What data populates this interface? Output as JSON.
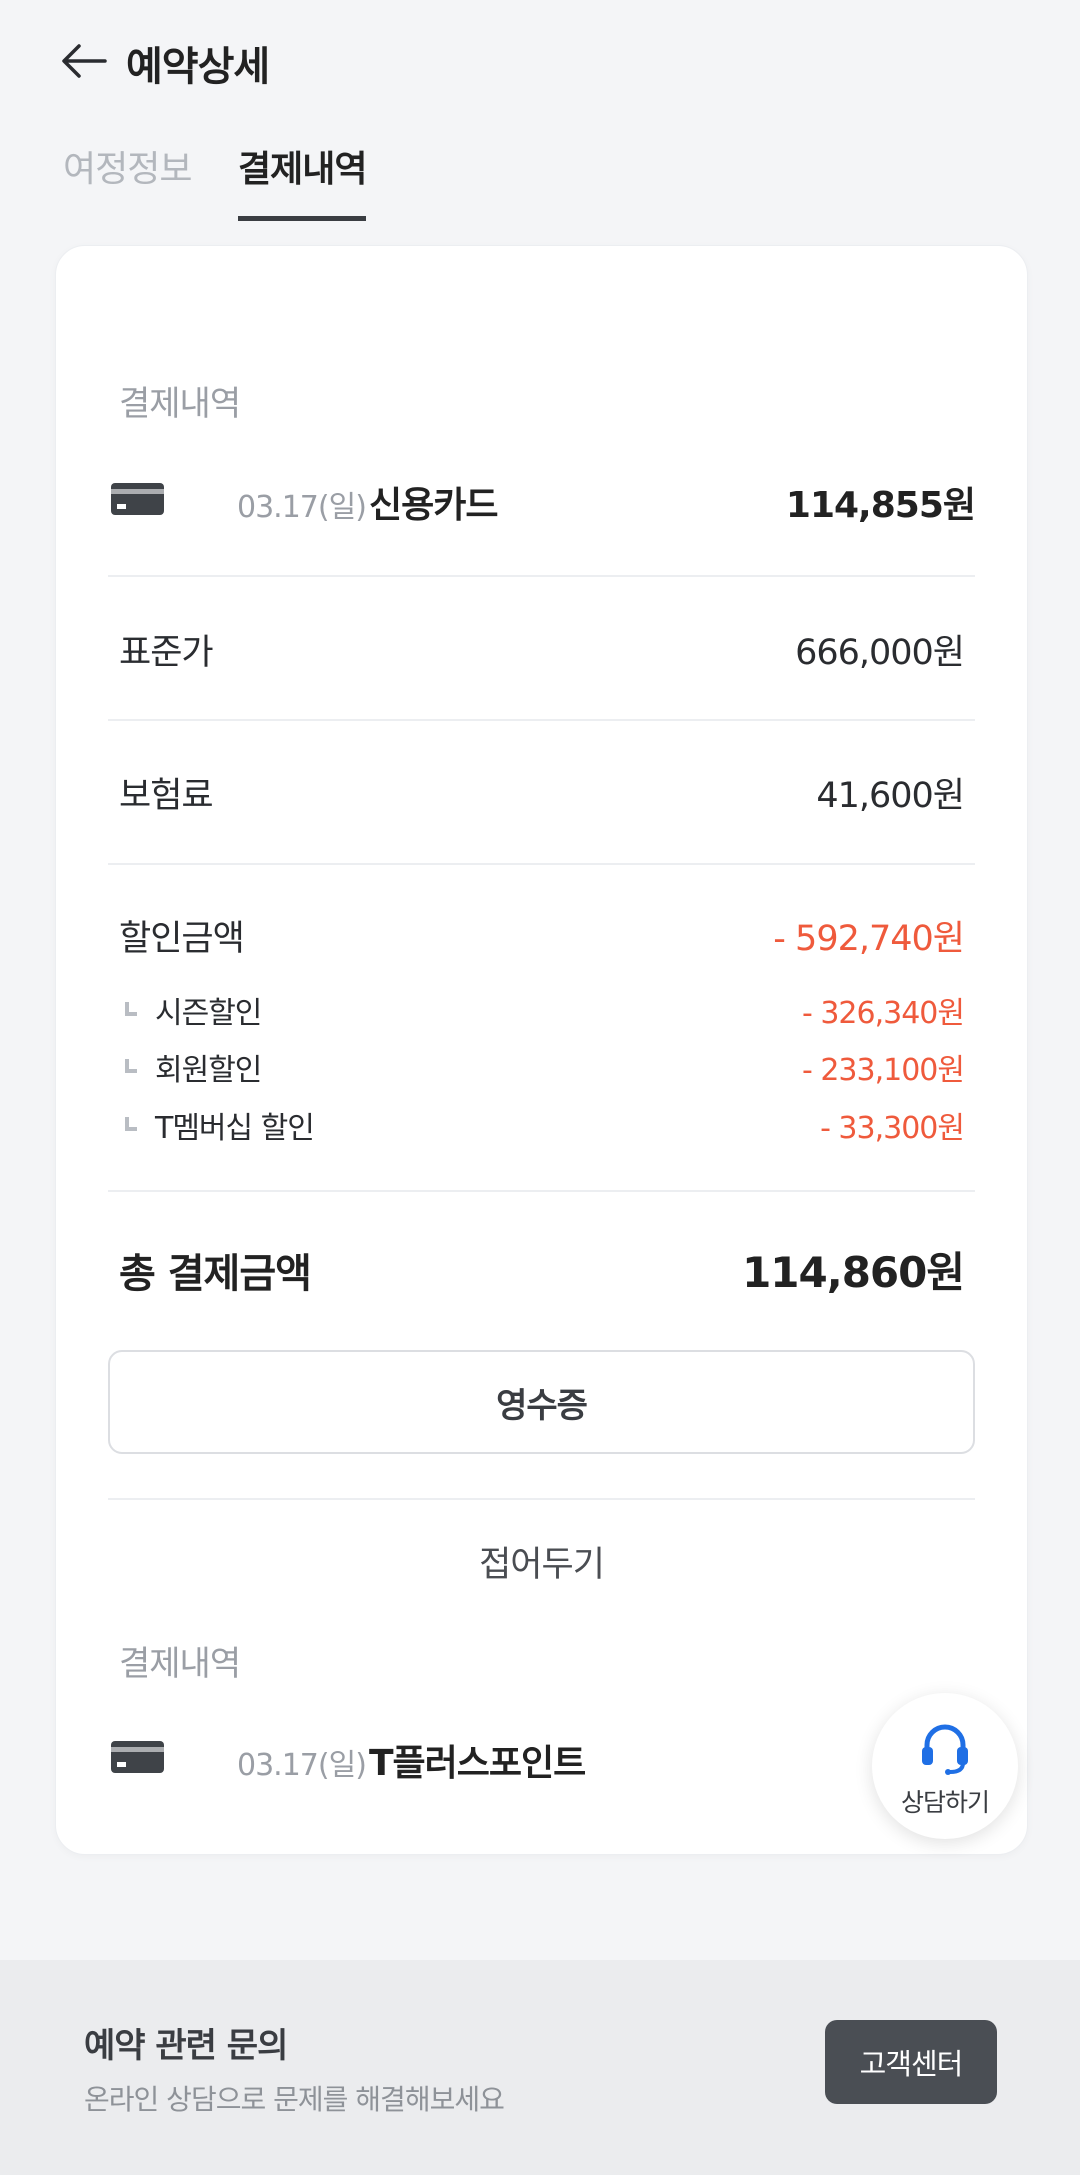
{
  "header": {
    "title": "예약상세",
    "back_icon": "arrow-left-icon"
  },
  "tabs": [
    {
      "label": "여정정보",
      "active": false
    },
    {
      "label": "결제내역",
      "active": true
    }
  ],
  "payment_section": {
    "label": "결제내역",
    "payment": {
      "icon": "credit-card-icon",
      "date": "03.17(일)",
      "method": "신용카드",
      "amount": "114,855원"
    },
    "standard_price": {
      "label": "표준가",
      "value": "666,000원"
    },
    "insurance": {
      "label": "보험료",
      "value": "41,600원"
    },
    "discount": {
      "label": "할인금액",
      "value": "- 592,740원",
      "items": [
        {
          "label": "시즌할인",
          "value": "- 326,340원"
        },
        {
          "label": "회원할인",
          "value": "- 233,100원"
        },
        {
          "label": "T멤버십 할인",
          "value": "- 33,300원"
        }
      ]
    },
    "total": {
      "label": "총 결제금액",
      "value": "114,860원"
    },
    "receipt_button": "영수증",
    "fold_button": "접어두기"
  },
  "second_section": {
    "label": "결제내역",
    "payment": {
      "icon": "credit-card-icon",
      "date": "03.17(일)",
      "method": "T플러스포인트"
    }
  },
  "consult_fab": {
    "icon": "headset-icon",
    "label": "상담하기"
  },
  "footer": {
    "title": "예약 관련 문의",
    "subtitle": "온라인 상담으로 문제를 해결해보세요",
    "button": "고객센터"
  },
  "colors": {
    "accent_red": "#ef5a3c",
    "headset_blue": "#1f6fe5",
    "dark_button": "#4a4e54"
  }
}
